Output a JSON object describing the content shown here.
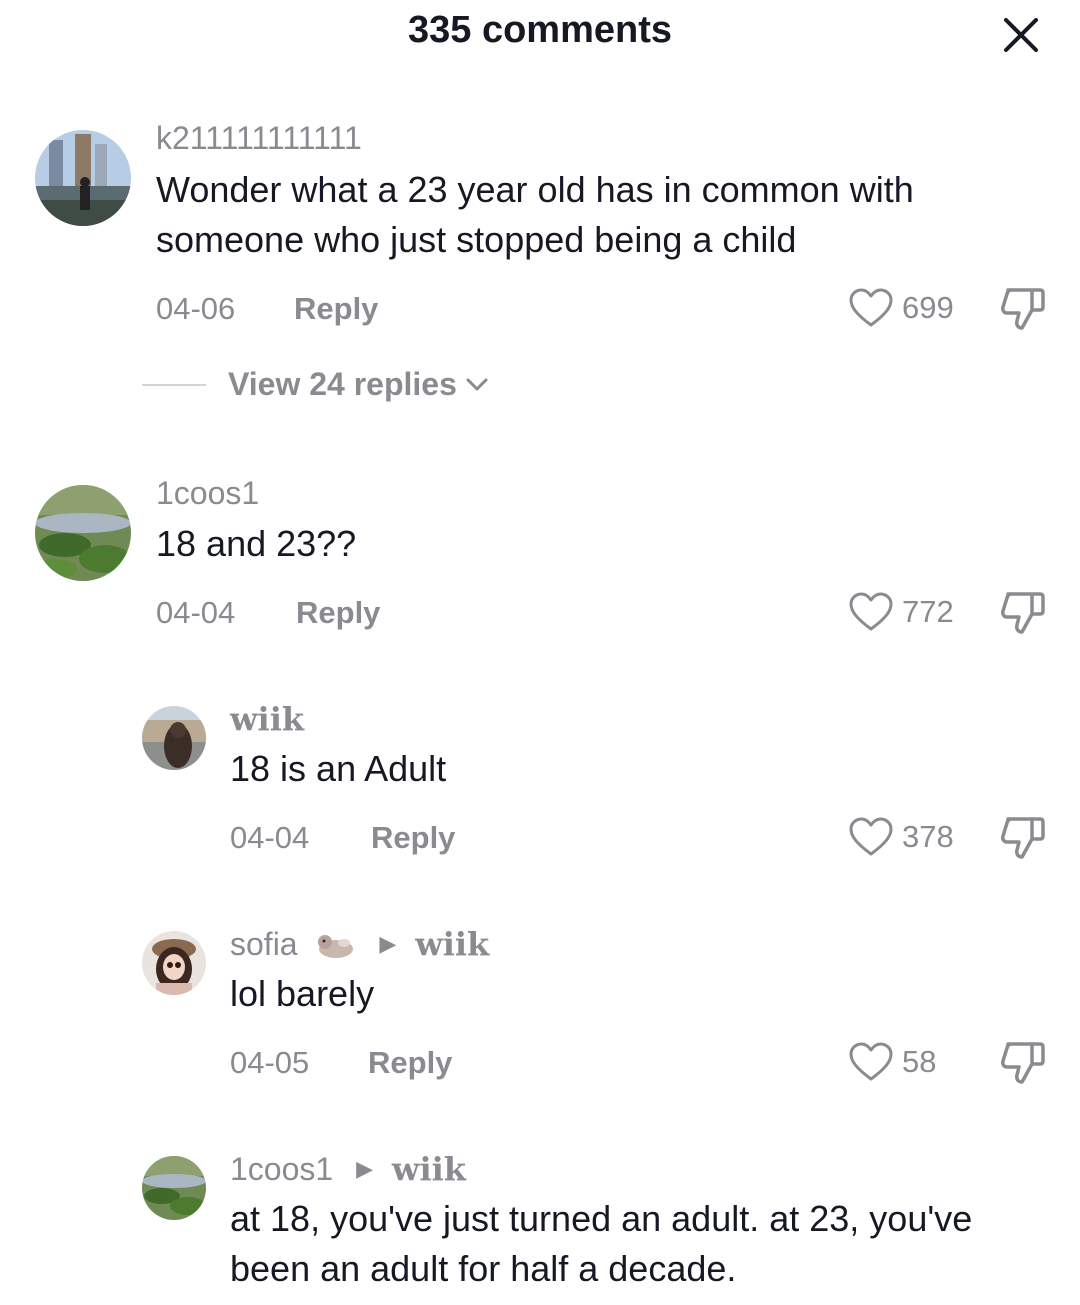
{
  "header": {
    "title": "335 comments"
  },
  "comments": [
    {
      "username": "k211111111111",
      "text": "Wonder what a 23 year old has in common with someone who just stopped being a child",
      "date": "04-06",
      "reply_label": "Reply",
      "likes": "699"
    },
    {
      "username": "1coos1",
      "text": "18 and 23??",
      "date": "04-04",
      "reply_label": "Reply",
      "likes": "772"
    }
  ],
  "view_replies": {
    "label": "View 24 replies"
  },
  "replies": [
    {
      "username": "wiik",
      "text": "18 is an Adult",
      "date": "04-04",
      "reply_label": "Reply",
      "likes": "378"
    },
    {
      "username": "sofia",
      "reply_to": "wiik",
      "text": "lol barely",
      "date": "04-05",
      "reply_label": "Reply",
      "likes": "58"
    },
    {
      "username": "1coos1",
      "reply_to": "wiik",
      "text": "at 18, you've just turned an adult. at 23, you've been an adult for half a decade."
    }
  ],
  "icons": {
    "close": "close-icon",
    "like": "heart-icon",
    "dislike": "thumbs-down-icon",
    "expand": "chevron-down-icon",
    "reply_arrow": "triangle-right-icon",
    "emoji": "otter-emoji-icon"
  },
  "colors": {
    "text": "#161823",
    "secondary": "#8a8b91",
    "background": "#ffffff"
  }
}
